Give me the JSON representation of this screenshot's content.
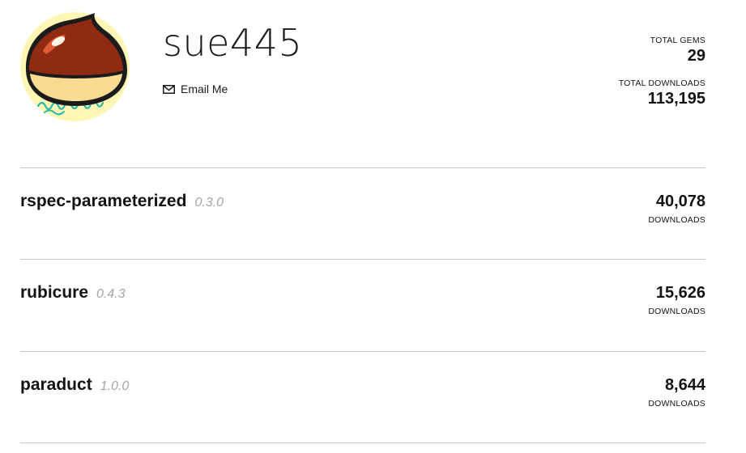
{
  "profile": {
    "username": "sue445",
    "email_label": "Email Me",
    "avatar_icon": "chestnut-avatar-icon",
    "avatar_colors": {
      "background": "#fdf6b4",
      "shell": "#8f2a13",
      "highlight": "#e05a35",
      "base": "#f9dc91",
      "scribble": "#2bb8a8"
    }
  },
  "stats": {
    "total_gems_label": "TOTAL GEMS",
    "total_gems": "29",
    "total_downloads_label": "TOTAL DOWNLOADS",
    "total_downloads": "113,195"
  },
  "gems": [
    {
      "name": "rspec-parameterized",
      "version": "0.3.0",
      "downloads": "40,078",
      "downloads_label": "DOWNLOADS"
    },
    {
      "name": "rubicure",
      "version": "0.4.3",
      "downloads": "15,626",
      "downloads_label": "DOWNLOADS"
    },
    {
      "name": "paraduct",
      "version": "1.0.0",
      "downloads": "8,644",
      "downloads_label": "DOWNLOADS"
    }
  ],
  "colors": {
    "text": "#141414",
    "muted": "#a5a5a5",
    "divider": "#c8c8c8"
  }
}
